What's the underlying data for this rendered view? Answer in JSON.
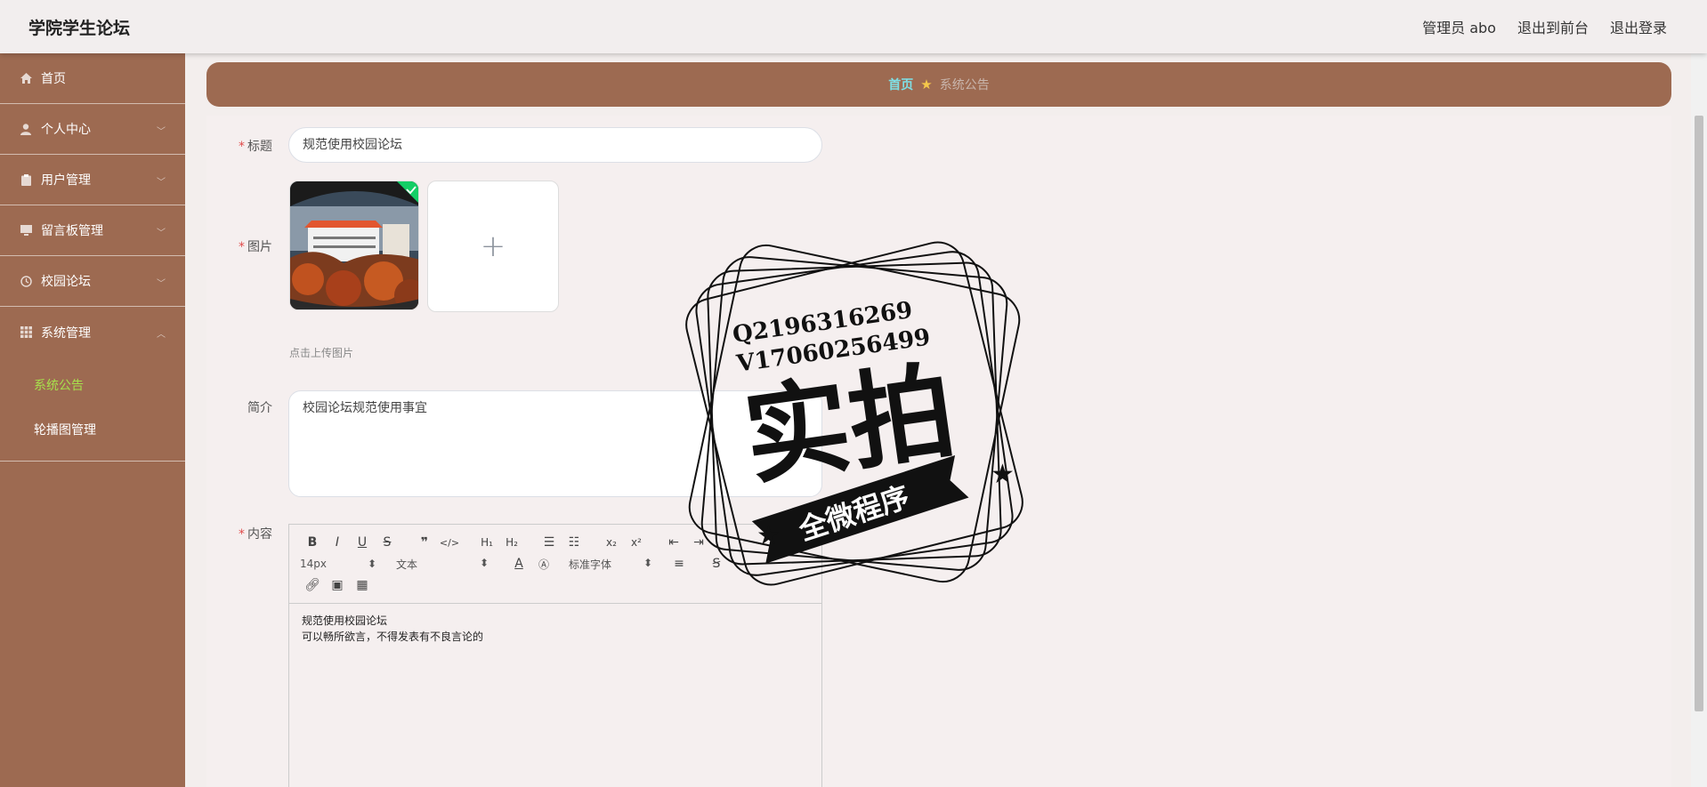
{
  "header": {
    "title": "学院学生论坛",
    "admin_label": "管理员 abo",
    "goto_front": "退出到前台",
    "logout": "退出登录"
  },
  "sidebar": {
    "items": [
      {
        "label": "首页",
        "icon": "home-icon"
      },
      {
        "label": "个人中心",
        "icon": "user-icon"
      },
      {
        "label": "用户管理",
        "icon": "clipboard-icon"
      },
      {
        "label": "留言板管理",
        "icon": "monitor-icon"
      },
      {
        "label": "校园论坛",
        "icon": "clock-icon"
      },
      {
        "label": "系统管理",
        "icon": "grid-icon"
      }
    ],
    "sub_items": [
      {
        "label": "系统公告",
        "active": true
      },
      {
        "label": "轮播图管理",
        "active": false
      }
    ],
    "active_color": "#a7e04c",
    "bg_color": "#9d6a51"
  },
  "breadcrumb": {
    "home": "首页",
    "current": "系统公告"
  },
  "form": {
    "title_label": "标题",
    "title_value": "规范使用校园论坛",
    "image_label": "图片",
    "upload_tip": "点击上传图片",
    "intro_label": "简介",
    "intro_value": "校园论坛规范使用事宜",
    "content_label": "内容"
  },
  "editor": {
    "font_size": "14px",
    "block_format": "文本",
    "font_family": "标准字体",
    "content_lines": [
      "规范使用校园论坛",
      "可以畅所欲言，不得发表有不良言论的"
    ]
  },
  "watermark": {
    "qq": "Q2196316269",
    "vx": "V17060256499",
    "big": "实拍",
    "banner": "全微程序"
  }
}
